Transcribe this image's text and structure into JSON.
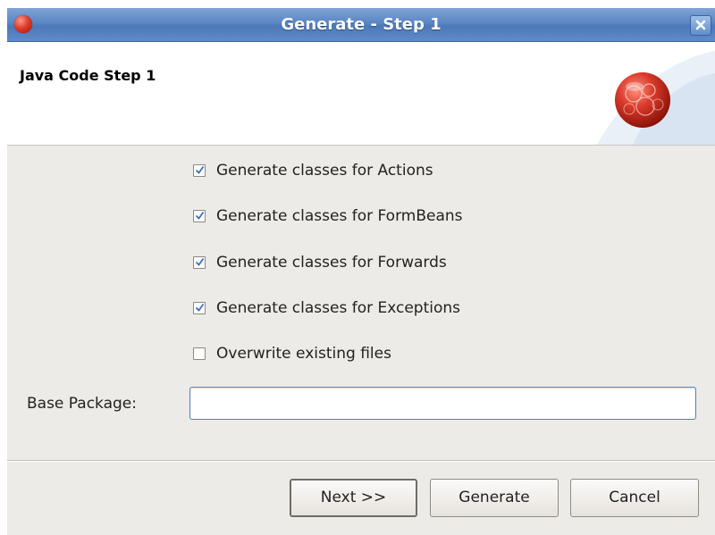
{
  "window": {
    "title": "Generate - Step 1",
    "icons": {
      "app": "app-icon",
      "close": "close-icon"
    }
  },
  "banner": {
    "title": "Java Code Step 1",
    "logo_icon": "red-sphere-logo-icon"
  },
  "options": [
    {
      "label": "Generate classes for Actions",
      "checked": true
    },
    {
      "label": "Generate classes for FormBeans",
      "checked": true
    },
    {
      "label": "Generate classes for Forwards",
      "checked": true
    },
    {
      "label": "Generate classes for Exceptions",
      "checked": true
    },
    {
      "label": "Overwrite existing files",
      "checked": false
    }
  ],
  "base_package": {
    "label": "Base Package:",
    "value": ""
  },
  "buttons": {
    "next": "Next >>",
    "generate": "Generate",
    "cancel": "Cancel"
  },
  "colors": {
    "titlebar": "#5a86c4",
    "check_mark": "#3a6fb8",
    "input_border": "#4c86c8",
    "logo": "#d93a2b"
  }
}
